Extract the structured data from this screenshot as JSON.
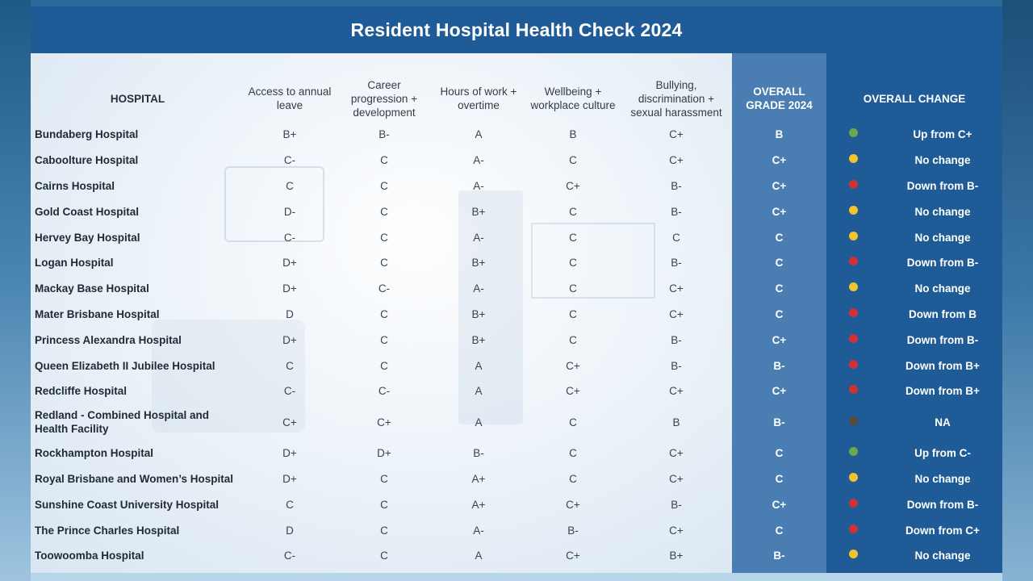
{
  "title": "Resident Hospital Health Check 2024",
  "headers": {
    "hospital": "HOSPITAL",
    "leave": "Access to annual leave",
    "career": "Career progression + development",
    "hours": "Hours of work + overtime",
    "wellbeing": "Wellbeing + workplace culture",
    "bullying": "Bullying, discrimination + sexual harassment",
    "overall_grade": "OVERALL GRADE 2024",
    "overall_change": "OVERALL CHANGE"
  },
  "colors": {
    "green": "#6aa84f",
    "yellow": "#f1c232",
    "red": "#cc3333",
    "brown": "#5a4a3a",
    "title_bar": "#1f5b96",
    "grade_col": "#4a7eb2"
  },
  "rows": [
    {
      "name": "Bundaberg Hospital",
      "leave": "B+",
      "career": "B-",
      "hours": "A",
      "wellbeing": "B",
      "bullying": "C+",
      "overall": "B",
      "dot": "green",
      "change": "Up from C+"
    },
    {
      "name": "Caboolture Hospital",
      "leave": "C-",
      "career": "C",
      "hours": "A-",
      "wellbeing": "C",
      "bullying": "C+",
      "overall": "C+",
      "dot": "yellow",
      "change": "No change"
    },
    {
      "name": "Cairns Hospital",
      "leave": "C",
      "career": "C",
      "hours": "A-",
      "wellbeing": "C+",
      "bullying": "B-",
      "overall": "C+",
      "dot": "red",
      "change": "Down from B-"
    },
    {
      "name": "Gold Coast Hospital",
      "leave": "D-",
      "career": "C",
      "hours": "B+",
      "wellbeing": "C",
      "bullying": "B-",
      "overall": "C+",
      "dot": "yellow",
      "change": "No change"
    },
    {
      "name": "Hervey Bay Hospital",
      "leave": "C-",
      "career": "C",
      "hours": "A-",
      "wellbeing": "C",
      "bullying": "C",
      "overall": "C",
      "dot": "yellow",
      "change": "No change"
    },
    {
      "name": "Logan Hospital",
      "leave": "D+",
      "career": "C",
      "hours": "B+",
      "wellbeing": "C",
      "bullying": "B-",
      "overall": "C",
      "dot": "red",
      "change": "Down from B-"
    },
    {
      "name": "Mackay Base Hospital",
      "leave": "D+",
      "career": "C-",
      "hours": "A-",
      "wellbeing": "C",
      "bullying": "C+",
      "overall": "C",
      "dot": "yellow",
      "change": "No change"
    },
    {
      "name": "Mater Brisbane Hospital",
      "leave": "D",
      "career": "C",
      "hours": "B+",
      "wellbeing": "C",
      "bullying": "C+",
      "overall": "C",
      "dot": "red",
      "change": "Down from B"
    },
    {
      "name": "Princess Alexandra Hospital",
      "leave": "D+",
      "career": "C",
      "hours": "B+",
      "wellbeing": "C",
      "bullying": "B-",
      "overall": "C+",
      "dot": "red",
      "change": "Down from B-"
    },
    {
      "name": "Queen Elizabeth II Jubilee Hospital",
      "leave": "C",
      "career": "C",
      "hours": "A",
      "wellbeing": "C+",
      "bullying": "B-",
      "overall": "B-",
      "dot": "red",
      "change": "Down from B+"
    },
    {
      "name": "Redcliffe Hospital",
      "leave": "C-",
      "career": "C-",
      "hours": "A",
      "wellbeing": "C+",
      "bullying": "C+",
      "overall": "C+",
      "dot": "red",
      "change": "Down from B+"
    },
    {
      "name": "Redland - Combined Hospital and Health Facility",
      "leave": "C+",
      "career": "C+",
      "hours": "A",
      "wellbeing": "C",
      "bullying": "B",
      "overall": "B-",
      "dot": "brown",
      "change": "NA"
    },
    {
      "name": "Rockhampton Hospital",
      "leave": "D+",
      "career": "D+",
      "hours": "B-",
      "wellbeing": "C",
      "bullying": "C+",
      "overall": "C",
      "dot": "green",
      "change": "Up from C-"
    },
    {
      "name": "Royal Brisbane and Women’s Hospital",
      "leave": "D+",
      "career": "C",
      "hours": "A+",
      "wellbeing": "C",
      "bullying": "C+",
      "overall": "C",
      "dot": "yellow",
      "change": "No change"
    },
    {
      "name": "Sunshine Coast University Hospital",
      "leave": "C",
      "career": "C",
      "hours": "A+",
      "wellbeing": "C+",
      "bullying": "B-",
      "overall": "C+",
      "dot": "red",
      "change": "Down from B-"
    },
    {
      "name": "The Prince Charles Hospital",
      "leave": "D",
      "career": "C",
      "hours": "A-",
      "wellbeing": "B-",
      "bullying": "C+",
      "overall": "C",
      "dot": "red",
      "change": "Down from C+"
    },
    {
      "name": "Toowoomba Hospital",
      "leave": "C-",
      "career": "C",
      "hours": "A",
      "wellbeing": "C+",
      "bullying": "B+",
      "overall": "B-",
      "dot": "yellow",
      "change": "No change"
    }
  ]
}
